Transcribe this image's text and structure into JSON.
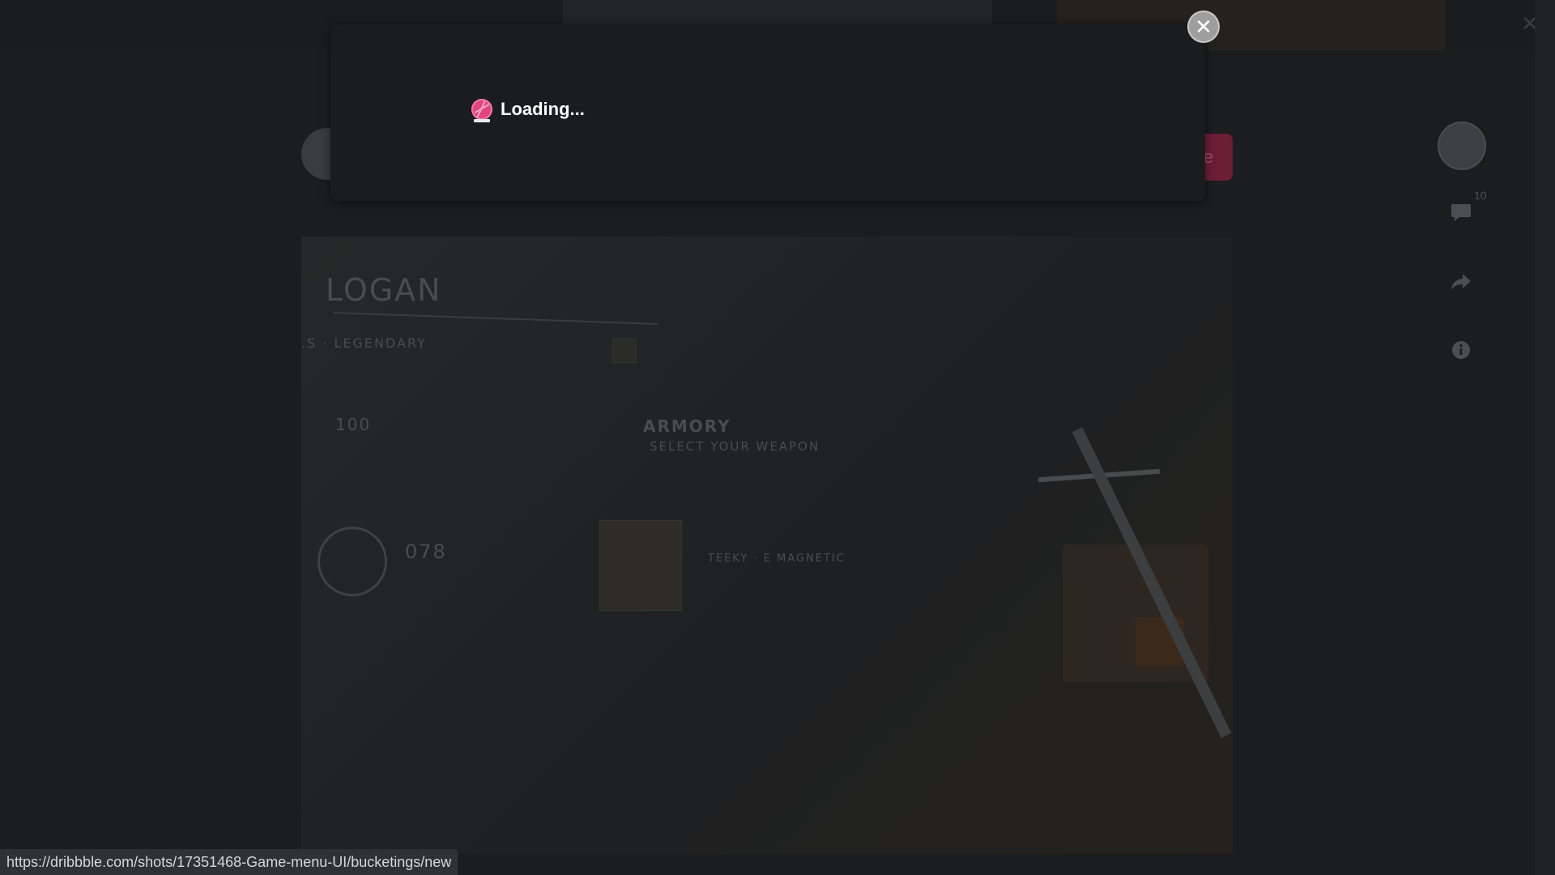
{
  "modal": {
    "loading_text": "Loading...",
    "close_symbol": "✕"
  },
  "background_page": {
    "close_symbol": "✕",
    "action_button_partial": "e",
    "comment_count": "10",
    "shot": {
      "player_name": "LOGAN",
      "rank": ".S · LEGENDARY",
      "level_value": "100",
      "counter_value": "078",
      "section_title": "ARMORY",
      "section_subtitle": "SELECT YOUR WEAPON",
      "weapon_name": "TEEKY · E MAGNETIC"
    }
  },
  "statusbar": {
    "url": "https://dribbble.com/shots/17351468-Game-menu-UI/bucketings/new"
  },
  "icons": {
    "comment": "comment-icon",
    "share": "share-icon",
    "info": "info-icon",
    "logo": "dribbble-logo-icon"
  },
  "colors": {
    "accent_pink": "#e0457b",
    "modal_bg": "#1b1c1e",
    "overlay_bg": "#1b1d1f"
  }
}
